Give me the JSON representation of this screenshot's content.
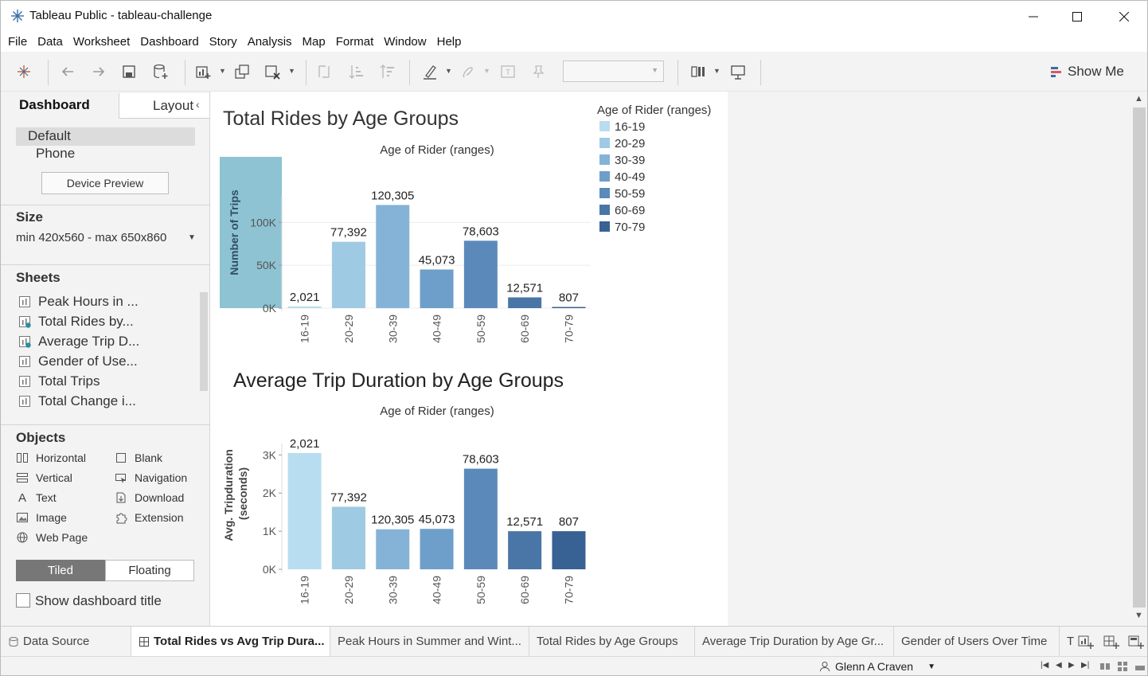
{
  "window": {
    "title": "Tableau Public - tableau-challenge"
  },
  "menu": [
    "File",
    "Data",
    "Worksheet",
    "Dashboard",
    "Story",
    "Analysis",
    "Map",
    "Format",
    "Window",
    "Help"
  ],
  "toolbar": {
    "show_me": "Show Me"
  },
  "left_panel": {
    "tabs": {
      "dashboard": "Dashboard",
      "layout": "Layout"
    },
    "devices": {
      "default": "Default",
      "phone": "Phone",
      "preview_button": "Device Preview"
    },
    "size": {
      "title": "Size",
      "value": "min 420x560 - max 650x860"
    },
    "sheets": {
      "title": "Sheets",
      "items": [
        "Peak Hours in ...",
        "Total  Rides by...",
        "Average Trip D...",
        "Gender of Use...",
        "Total Trips",
        "Total Change i..."
      ]
    },
    "objects": {
      "title": "Objects",
      "left": [
        {
          "label": "Horizontal",
          "icon": "horizontal-icon"
        },
        {
          "label": "Vertical",
          "icon": "vertical-icon"
        },
        {
          "label": "Text",
          "icon": "text-icon"
        },
        {
          "label": "Image",
          "icon": "image-icon"
        },
        {
          "label": "Web Page",
          "icon": "globe-icon"
        }
      ],
      "right": [
        {
          "label": "Blank",
          "icon": "blank-icon"
        },
        {
          "label": "Navigation",
          "icon": "navigation-icon"
        },
        {
          "label": "Download",
          "icon": "download-icon"
        },
        {
          "label": "Extension",
          "icon": "extension-icon"
        }
      ]
    },
    "tiled": "Tiled",
    "floating": "Floating",
    "show_title": "Show dashboard title"
  },
  "legend": {
    "title": "Age of Rider (ranges)",
    "items": [
      {
        "label": "16-19",
        "color": "#b9ddf0"
      },
      {
        "label": "20-29",
        "color": "#9fcae3"
      },
      {
        "label": "30-39",
        "color": "#85b3d8"
      },
      {
        "label": "40-49",
        "color": "#6e9fca"
      },
      {
        "label": "50-59",
        "color": "#5b8aba"
      },
      {
        "label": "60-69",
        "color": "#4a76a7"
      },
      {
        "label": "70-79",
        "color": "#386293"
      }
    ]
  },
  "chart_data": [
    {
      "type": "bar",
      "title": "Total  Rides by Age Groups",
      "xlabel": "Age of Rider (ranges)",
      "ylabel": "Number of Trips",
      "categories": [
        "16-19",
        "20-29",
        "30-39",
        "40-49",
        "50-59",
        "60-69",
        "70-79"
      ],
      "values": [
        2021,
        77392,
        120305,
        45073,
        78603,
        12571,
        807
      ],
      "labels": [
        "2,021",
        "77,392",
        "120,305",
        "45,073",
        "78,603",
        "12,571",
        "807"
      ],
      "yticks": [
        "0K",
        "50K",
        "100K"
      ],
      "ylim": [
        0,
        130000
      ],
      "grid": true
    },
    {
      "type": "bar",
      "title": "Average Trip Duration by Age Groups",
      "xlabel": "Age of Rider (ranges)",
      "ylabel": "Avg. Tripduration (seconds)",
      "categories": [
        "16-19",
        "20-29",
        "30-39",
        "40-49",
        "50-59",
        "60-69",
        "70-79"
      ],
      "values": [
        3050,
        1640,
        1050,
        1060,
        2640,
        1000,
        1000
      ],
      "labels": [
        "2,021",
        "77,392",
        "120,305",
        "45,073",
        "78,603",
        "12,571",
        "807"
      ],
      "yticks": [
        "0K",
        "1K",
        "2K",
        "3K"
      ],
      "ylim": [
        0,
        3300
      ],
      "grid": false
    }
  ],
  "bottom_tabs": [
    {
      "label": "Data Source",
      "icon": "database-icon",
      "active": false
    },
    {
      "label": "Total Rides vs Avg Trip Dura...",
      "icon": "dashboard-icon",
      "active": true
    },
    {
      "label": "Peak Hours in Summer and Wint...",
      "active": false
    },
    {
      "label": "Total  Rides by Age Groups",
      "active": false
    },
    {
      "label": "Average Trip Duration by Age Gr...",
      "active": false
    },
    {
      "label": "Gender of Users Over Time",
      "active": false
    },
    {
      "label": "T",
      "active": false
    }
  ],
  "status": {
    "user": "Glenn A Craven"
  }
}
